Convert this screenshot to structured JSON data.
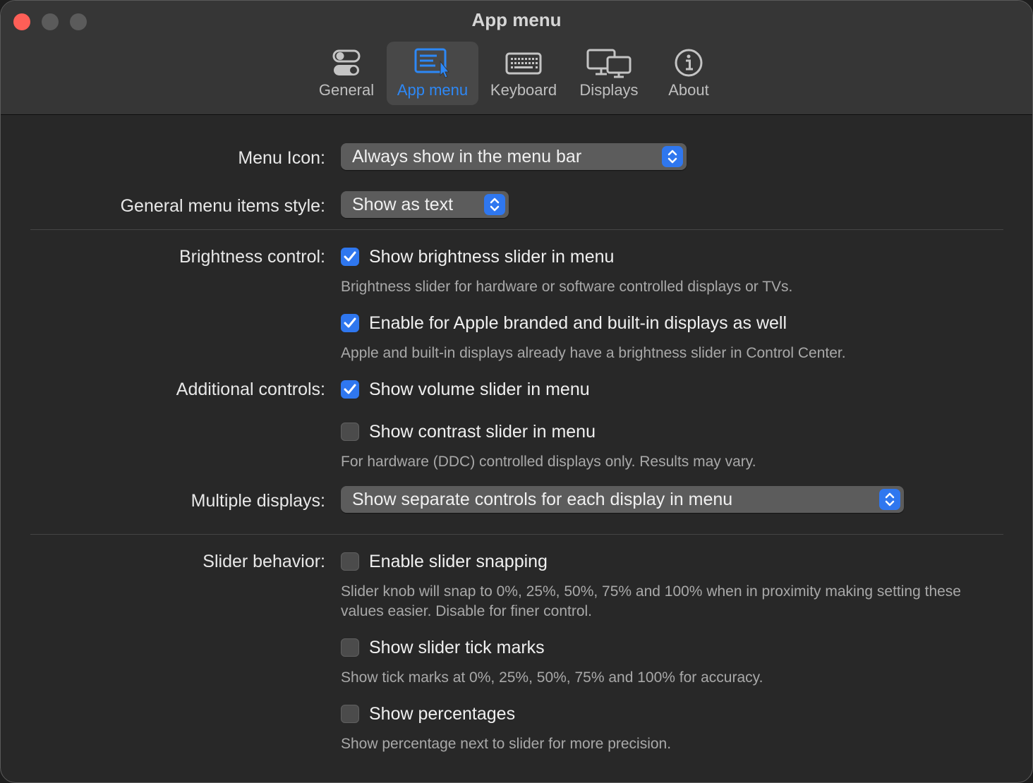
{
  "window": {
    "title": "App menu"
  },
  "toolbar": {
    "tabs": [
      {
        "label": "General",
        "icon": "toggles-icon",
        "active": false
      },
      {
        "label": "App menu",
        "icon": "menu-window-icon",
        "active": true
      },
      {
        "label": "Keyboard",
        "icon": "keyboard-icon",
        "active": false
      },
      {
        "label": "Displays",
        "icon": "displays-icon",
        "active": false
      },
      {
        "label": "About",
        "icon": "info-icon",
        "active": false
      }
    ]
  },
  "settings": {
    "menu_icon": {
      "label": "Menu Icon:",
      "value": "Always show in the menu bar"
    },
    "menu_items_style": {
      "label": "General menu items style:",
      "value": "Show as text"
    },
    "brightness": {
      "label": "Brightness control:",
      "slider_label": "Show brightness slider in menu",
      "slider_checked": true,
      "slider_note": "Brightness slider for hardware or software controlled displays or TVs.",
      "apple_label": "Enable for Apple branded and built-in displays as well",
      "apple_checked": true,
      "apple_note": "Apple and built-in displays already have a brightness slider in Control Center."
    },
    "additional": {
      "label": "Additional controls:",
      "volume_label": "Show volume slider in menu",
      "volume_checked": true,
      "contrast_label": "Show contrast slider in menu",
      "contrast_checked": false,
      "contrast_note": "For hardware (DDC) controlled displays only. Results may vary."
    },
    "multiple_displays": {
      "label": "Multiple displays:",
      "value": "Show separate controls for each display in menu"
    },
    "slider_behavior": {
      "label": "Slider behavior:",
      "snapping_label": "Enable slider snapping",
      "snapping_checked": false,
      "snapping_note": "Slider knob will snap to 0%, 25%, 50%, 75% and 100% when in proximity making setting these values easier. Disable for finer control.",
      "ticks_label": "Show slider tick marks",
      "ticks_checked": false,
      "ticks_note": "Show tick marks at 0%, 25%, 50%, 75% and 100% for accuracy.",
      "percent_label": "Show percentages",
      "percent_checked": false,
      "percent_note": "Show percentage next to slider for more precision."
    }
  },
  "colors": {
    "accent": "#2f77ef",
    "close_button": "#fe5f57",
    "active_tab_text": "#2d88f6"
  }
}
